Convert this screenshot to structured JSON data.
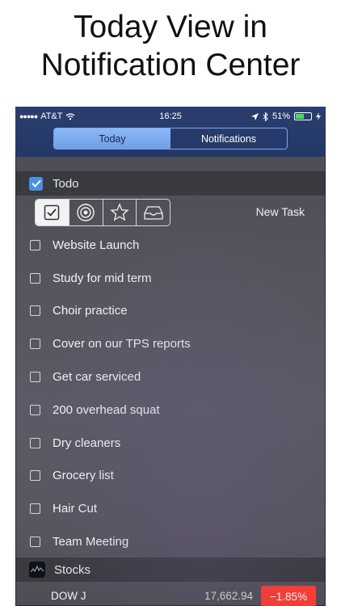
{
  "headline": {
    "line1": "Today View in",
    "line2": "Notification Center"
  },
  "status_bar": {
    "carrier": "AT&T",
    "time": "16:25",
    "battery_percent": "51%",
    "battery_level": 0.51
  },
  "segment": {
    "today_label": "Today",
    "notifications_label": "Notifications",
    "selected": "Today"
  },
  "todo": {
    "header": "Todo",
    "new_task_label": "New Task",
    "tasks": [
      {
        "label": "Website Launch"
      },
      {
        "label": "Study for mid term"
      },
      {
        "label": "Choir practice"
      },
      {
        "label": "Cover on our TPS reports"
      },
      {
        "label": "Get car serviced"
      },
      {
        "label": "200 overhead squat"
      },
      {
        "label": "Dry cleaners"
      },
      {
        "label": "Grocery list"
      },
      {
        "label": "Hair Cut"
      },
      {
        "label": "Team Meeting"
      }
    ]
  },
  "stocks": {
    "header": "Stocks",
    "items": [
      {
        "name": "DOW J",
        "price": "17,662.94",
        "change": "−1.85%"
      }
    ]
  },
  "colors": {
    "accent_blue": "#4a90e2",
    "negative_red": "#ff3b30",
    "battery_green": "#4cd964",
    "topbar_navy": "#243868"
  },
  "icons": {
    "toolbar": [
      "checkmark-icon",
      "target-icon",
      "star-icon",
      "inbox-icon"
    ]
  }
}
